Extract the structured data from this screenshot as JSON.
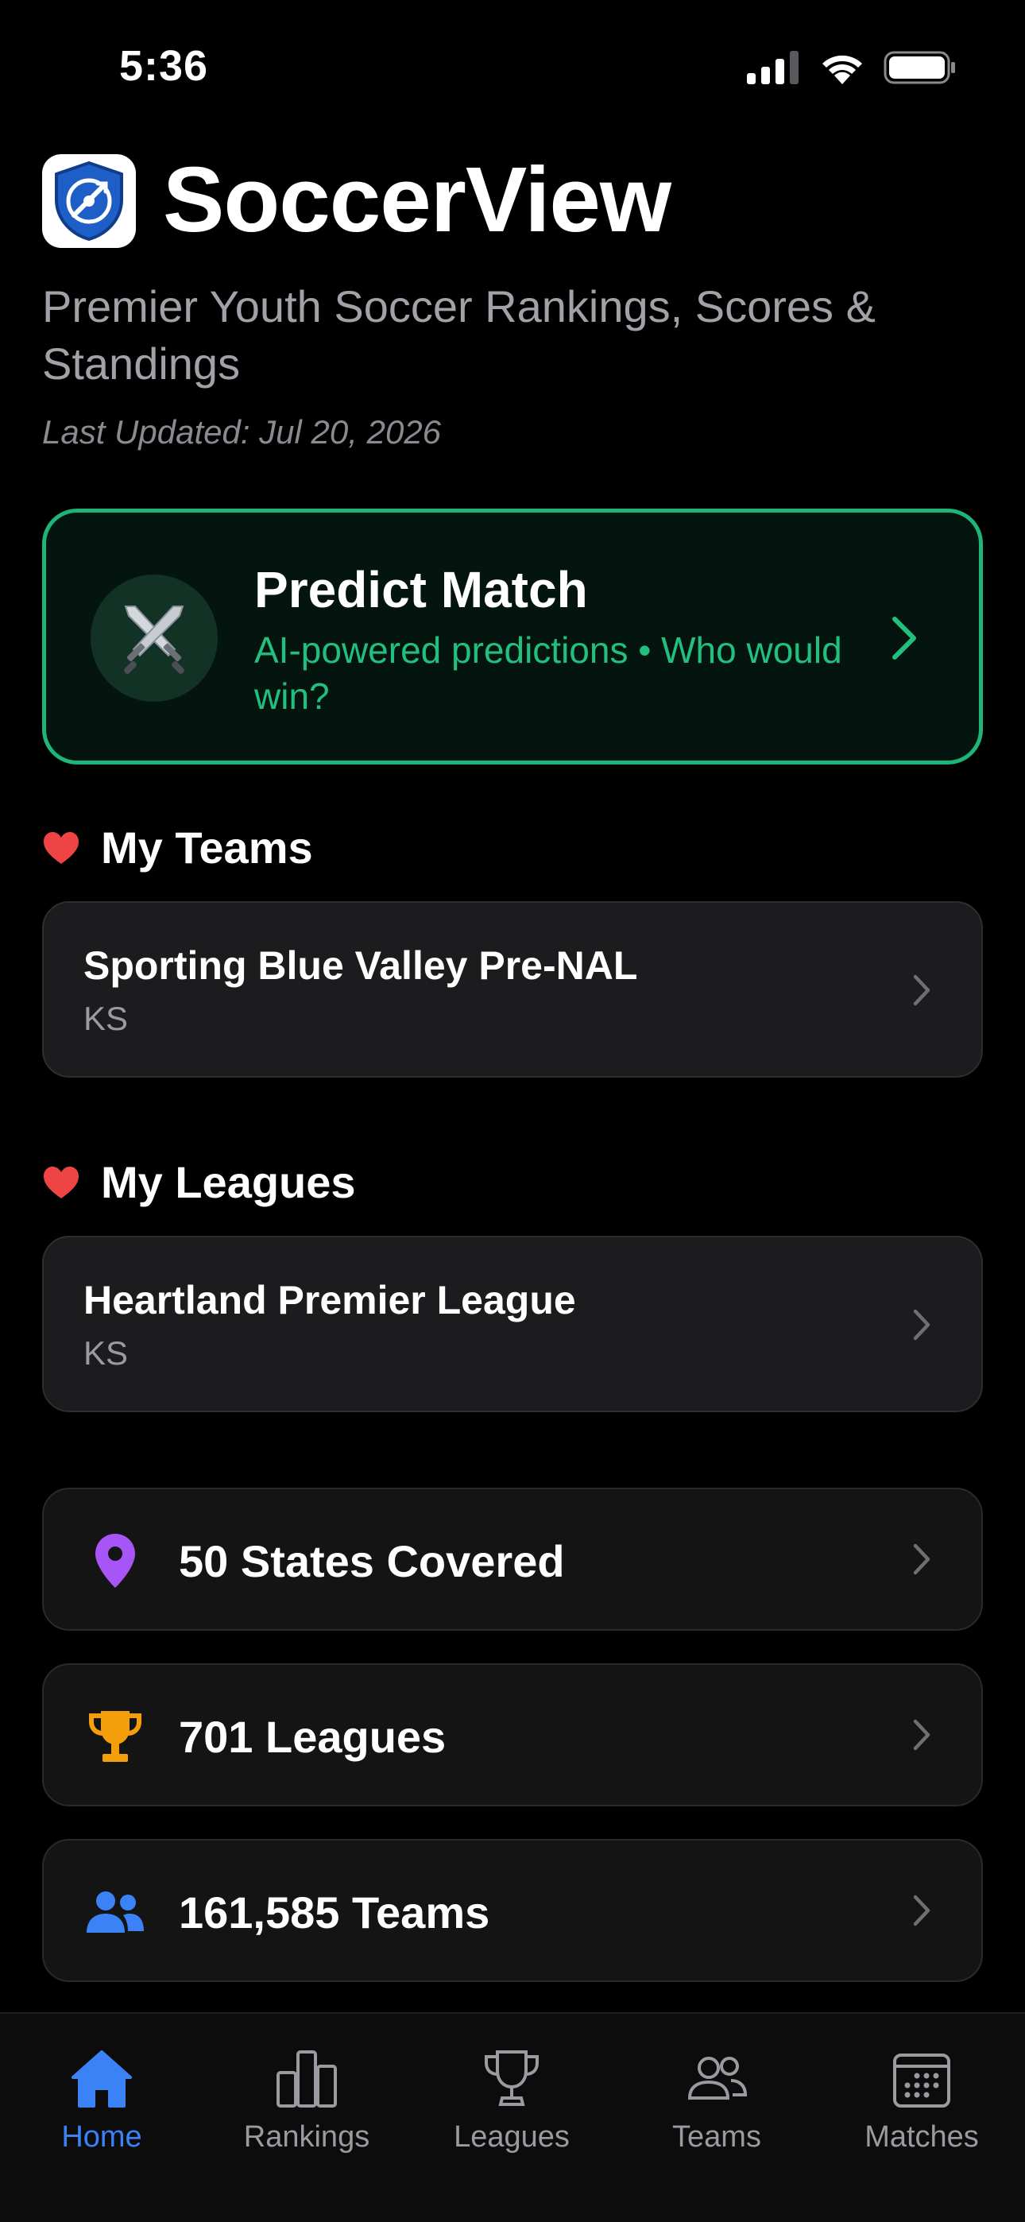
{
  "status_bar": {
    "time": "5:36"
  },
  "header": {
    "title": "SoccerView",
    "subtitle": "Premier Youth Soccer Rankings, Scores & Standings",
    "last_updated": "Last Updated: Jul 20, 2026"
  },
  "predict": {
    "icon": "crossed-swords-icon",
    "title": "Predict Match",
    "subtitle": "AI-powered predictions • Who would win?"
  },
  "my_teams": {
    "title": "My Teams",
    "items": [
      {
        "name": "Sporting Blue Valley Pre-NAL",
        "state": "KS"
      }
    ]
  },
  "my_leagues": {
    "title": "My Leagues",
    "items": [
      {
        "name": "Heartland Premier League",
        "state": "KS"
      }
    ]
  },
  "stats": [
    {
      "icon": "map-pin-icon",
      "label": "50 States Covered",
      "color": "#a855f7"
    },
    {
      "icon": "trophy-icon",
      "label": "701 Leagues",
      "color": "#f59e0b"
    },
    {
      "icon": "people-icon",
      "label": "161,585 Teams",
      "color": "#3b82f6"
    }
  ],
  "tabs": [
    {
      "icon": "home-icon",
      "label": "Home",
      "active": true
    },
    {
      "icon": "bar-chart-icon",
      "label": "Rankings",
      "active": false
    },
    {
      "icon": "trophy-outline-icon",
      "label": "Leagues",
      "active": false
    },
    {
      "icon": "people-outline-icon",
      "label": "Teams",
      "active": false
    },
    {
      "icon": "calendar-icon",
      "label": "Matches",
      "active": false
    }
  ],
  "colors": {
    "accent_green": "#22c07f",
    "accent_blue": "#3b82f6",
    "heart_red": "#ef4444",
    "background": "#000000"
  }
}
